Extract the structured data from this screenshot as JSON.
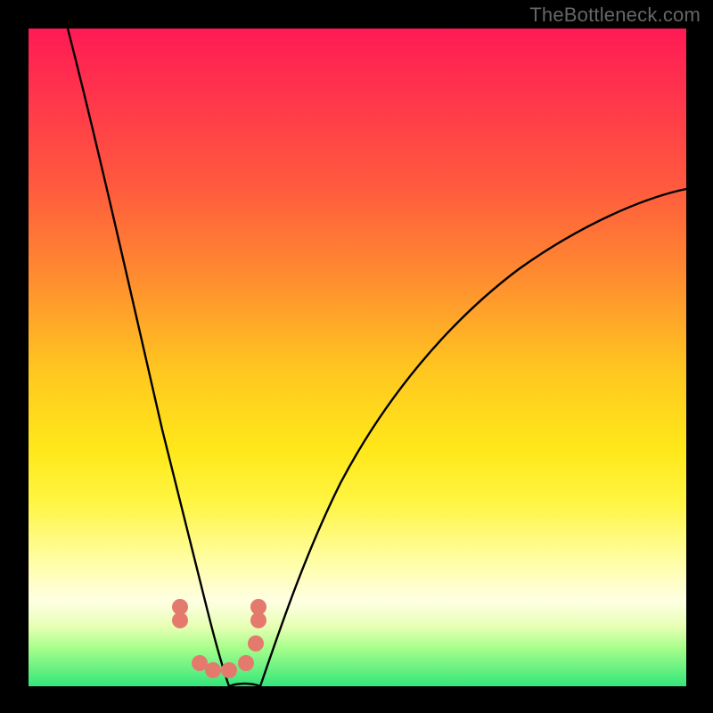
{
  "watermark": "TheBottleneck.com",
  "chart_data": {
    "type": "line",
    "title": "",
    "xlabel": "",
    "ylabel": "",
    "xlim": [
      0,
      100
    ],
    "ylim": [
      0,
      100
    ],
    "grid": false,
    "legend": false,
    "background_gradient": [
      "#ff1a55",
      "#ff5a3e",
      "#ffe81a",
      "#ffffe3",
      "#34e67a"
    ],
    "series": [
      {
        "name": "curve-left",
        "x": [
          6,
          9,
          12,
          15,
          18,
          21,
          24,
          26,
          28,
          30
        ],
        "values": [
          100,
          78,
          58,
          42,
          30,
          20,
          12,
          6,
          2,
          0
        ]
      },
      {
        "name": "curve-right",
        "x": [
          30,
          33,
          36,
          40,
          45,
          50,
          56,
          64,
          73,
          83,
          94,
          100
        ],
        "values": [
          0,
          2,
          6,
          12,
          20,
          28,
          36,
          45,
          54,
          62,
          69,
          72
        ]
      }
    ],
    "markers": {
      "color": "#e47a6e",
      "points_xy": [
        [
          23,
          12
        ],
        [
          23,
          10
        ],
        [
          26,
          3.5
        ],
        [
          28,
          2.5
        ],
        [
          30.5,
          2.5
        ],
        [
          33,
          3.5
        ],
        [
          34.5,
          6.5
        ],
        [
          35,
          10
        ],
        [
          35,
          12
        ]
      ]
    }
  }
}
